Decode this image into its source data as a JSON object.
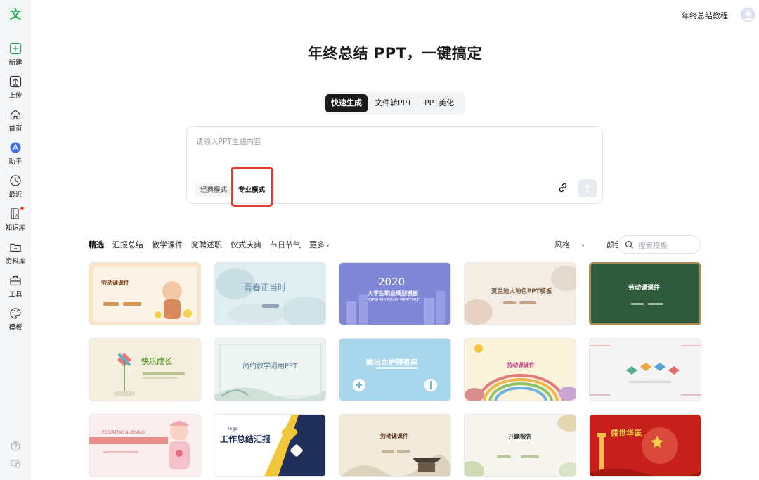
{
  "app": {
    "logo_char": "文",
    "top_right_title": "年终总结教程"
  },
  "sidebar": {
    "items": [
      {
        "label": "新建",
        "icon": "plus-icon"
      },
      {
        "label": "上传",
        "icon": "upload-icon"
      },
      {
        "label": "首页",
        "icon": "home-icon"
      },
      {
        "label": "助手",
        "icon": "assistant-icon"
      },
      {
        "label": "最近",
        "icon": "clock-icon"
      },
      {
        "label": "知识库",
        "icon": "knowledge-base-icon"
      },
      {
        "label": "资料库",
        "icon": "folder-icon"
      },
      {
        "label": "工具",
        "icon": "toolbox-icon"
      },
      {
        "label": "模板",
        "icon": "palette-icon"
      }
    ],
    "bottom_icons": [
      "help-icon",
      "device-icon"
    ]
  },
  "main": {
    "title": "年终总结 PPT，一键搞定",
    "tabs": [
      {
        "label": "快速生成",
        "active": true
      },
      {
        "label": "文件转PPT",
        "active": false
      },
      {
        "label": "PPT美化",
        "active": false
      }
    ],
    "input": {
      "placeholder": "请输入PPT主题内容",
      "modes": [
        "经典模式",
        "专业模式"
      ],
      "selected_mode": "专业模式"
    },
    "categories": [
      "精选",
      "汇报总结",
      "教学课件",
      "竞聘述职",
      "仪式庆典",
      "节日节气",
      "更多"
    ],
    "filters": [
      "风格",
      "颜色"
    ],
    "search_placeholder": "搜索模板",
    "templates": [
      {
        "title": "劳动课课件",
        "bg": "#fbe3c8"
      },
      {
        "title": "青春正当时",
        "bg": "#dfeef0"
      },
      {
        "title": "2020",
        "subtitle": "大学生职业规划模板",
        "sub2": "DEBRIEFING REPORT",
        "bg": "#7f86d8"
      },
      {
        "title": "莫兰迪大地色PPT模板",
        "bg": "#f4ede6"
      },
      {
        "title": "劳动课课件",
        "bg": "#2f5a3c"
      },
      {
        "title": "快乐成长",
        "bg": "#f4efdf"
      },
      {
        "title": "简约教学通用PPT",
        "bg": "#eef4f1"
      },
      {
        "title": "脑出血护理查房",
        "bg": "#9fd1ea"
      },
      {
        "title": "劳动课课件",
        "bg": "#fbf3dc"
      },
      {
        "title": "",
        "bg": "#f4f4f4"
      },
      {
        "title": "PEDIATRIC  NURSING",
        "bg": "#fbeeee"
      },
      {
        "title": "工作总结汇报",
        "bg": "#ffffff"
      },
      {
        "title": "劳动课课件",
        "bg": "#f2eadb"
      },
      {
        "title": "开题报告",
        "bg": "#f7f5ef"
      },
      {
        "title": "盛世华诞",
        "bg": "#c61f1c"
      }
    ]
  }
}
